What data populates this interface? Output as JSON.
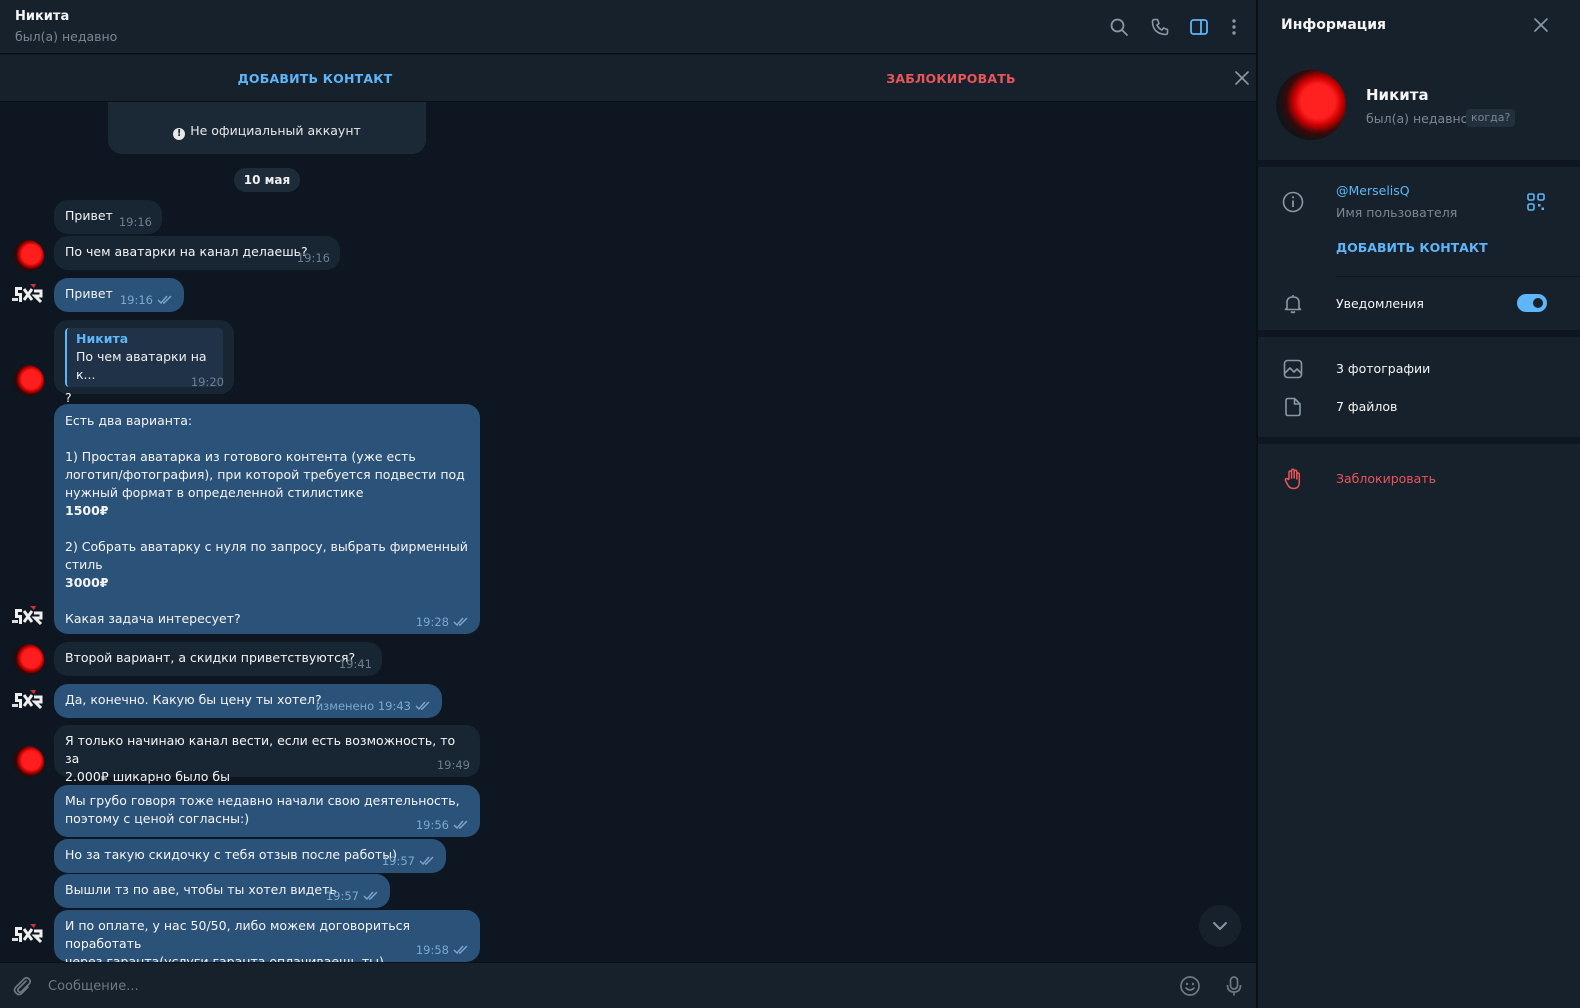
{
  "header": {
    "name": "Никита",
    "status": "был(а) недавно"
  },
  "action_bar": {
    "add_contact": "ДОБАВИТЬ КОНТАКТ",
    "block": "ЗАБЛОКИРОВАТЬ"
  },
  "service_card": {
    "note": "Не официальный аккаунт"
  },
  "date_chip": "10 мая",
  "messages": [
    {
      "dir": "in",
      "text": "Привет",
      "time": "19:16"
    },
    {
      "dir": "in",
      "text": "По чем аватарки на канал делаешь?",
      "time": "19:16"
    },
    {
      "dir": "out",
      "text": "Привет",
      "time": "19:16"
    },
    {
      "dir": "in",
      "reply_name": "Никита",
      "reply_text": "По чем аватарки на к...",
      "text": "?",
      "time": "19:20"
    },
    {
      "dir": "out",
      "lines": [
        "Есть два варианта:",
        "",
        "1) Простая аватарка из готового контента (уже есть",
        "логотип/фотография), при которой требуется подвести под",
        "нужный формат в определенной стилистике",
        "1500₽",
        "",
        "2) Собрать аватарку с нуля по запросу, выбрать фирменный",
        "стиль",
        "3000₽",
        "",
        "Какая задача интересует?"
      ],
      "time": "19:28"
    },
    {
      "dir": "in",
      "text": "Второй вариант, а скидки приветствуются?",
      "time": "19:41"
    },
    {
      "dir": "out",
      "text": "Да, конечно. Какую бы цену ты хотел?",
      "time": "изменено 19:43"
    },
    {
      "dir": "in",
      "lines": [
        "Я только начинаю канал вести, если есть возможность, то за",
        "2.000₽ шикарно было бы"
      ],
      "time": "19:49"
    },
    {
      "dir": "out",
      "lines": [
        "Мы грубо говоря тоже недавно начали свою деятельность,",
        "поэтому с ценой согласны:)"
      ],
      "time": "19:56"
    },
    {
      "dir": "out",
      "text": "Но за такую скидочку с тебя отзыв после работы)",
      "time": "19:57"
    },
    {
      "dir": "out",
      "text": "Вышли тз по аве, чтобы ты хотел видеть",
      "time": "19:57"
    },
    {
      "dir": "out",
      "lines": [
        "И по оплате, у нас 50/50, либо можем договориться поработать",
        "через гаранта(услуги гаранта оплачиваешь ты)"
      ],
      "time": "19:58"
    }
  ],
  "composer": {
    "placeholder": "Сообщение..."
  },
  "info_panel": {
    "title": "Информация",
    "name": "Никита",
    "status": "был(а) недавно",
    "when_chip": "когда?",
    "username": "@MerselisQ",
    "username_label": "Имя пользователя",
    "add_contact": "ДОБАВИТЬ КОНТАКТ",
    "notifications_label": "Уведомления",
    "notifications_on": true,
    "photos": "3 фотографии",
    "files": "7 файлов",
    "block": "Заблокировать"
  },
  "colors": {
    "accent": "#5eb5f7",
    "danger": "#e8555a",
    "bg": "#0e1621",
    "panel": "#17212b",
    "bubble_in": "#182533",
    "bubble_out": "#2b5278"
  }
}
